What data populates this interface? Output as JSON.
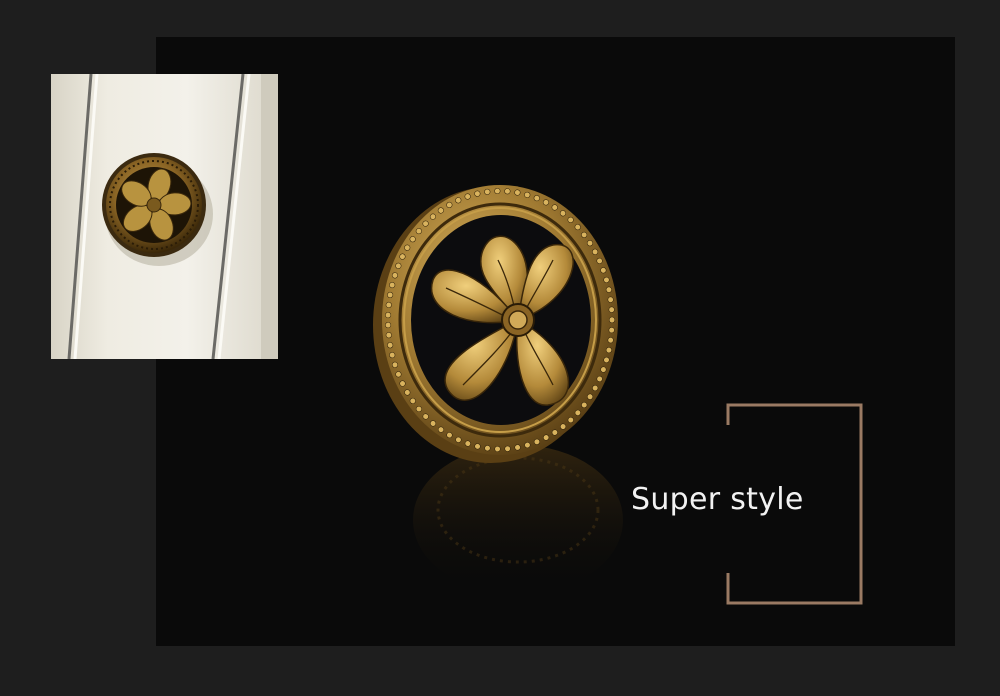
{
  "caption": {
    "text": "Super style"
  },
  "images": {
    "main": "antique-bronze-floral-cabinet-knob",
    "inset": "knob-mounted-on-cream-cabinet-door"
  },
  "colors": {
    "background": "#1e1e1e",
    "panel": "#0a0a0a",
    "bronze": "#b08a3c",
    "bronze_dark": "#5a3f15",
    "bracket": "#9a7a63",
    "caption": "#f2f2f2"
  }
}
